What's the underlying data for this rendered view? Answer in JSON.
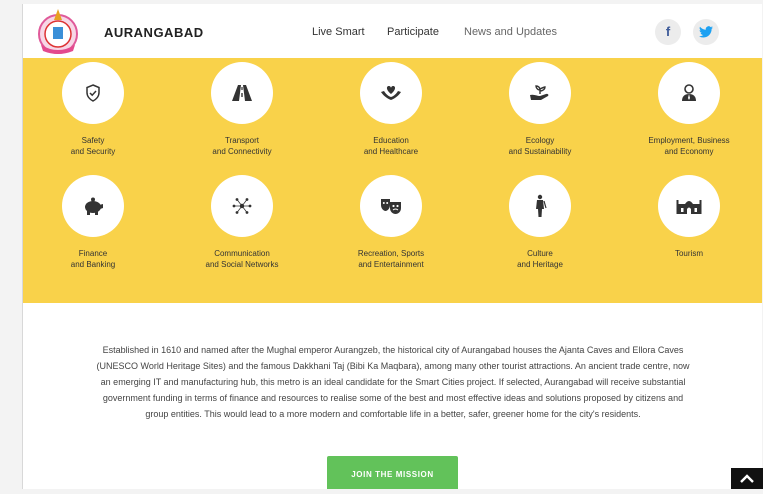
{
  "header": {
    "city_name": "AURANGABAD",
    "nav": [
      "Live Smart",
      "Participate",
      "News and Updates"
    ],
    "social": {
      "facebook": "f",
      "twitter": "t"
    }
  },
  "categories": [
    {
      "line1": "Safety",
      "line2": "and Security",
      "icon": "shield-check-icon"
    },
    {
      "line1": "Transport",
      "line2": "and Connectivity",
      "icon": "road-icon"
    },
    {
      "line1": "Education",
      "line2": "and Healthcare",
      "icon": "heart-hands-icon"
    },
    {
      "line1": "Ecology",
      "line2": "and Sustainability",
      "icon": "plant-hand-icon"
    },
    {
      "line1": "Employment, Business",
      "line2": "and Economy",
      "icon": "person-icon"
    },
    {
      "line1": "Finance",
      "line2": "and Banking",
      "icon": "piggy-bank-icon"
    },
    {
      "line1": "Communication",
      "line2": "and Social Networks",
      "icon": "network-icon"
    },
    {
      "line1": "Recreation, Sports",
      "line2": "and Entertainment",
      "icon": "theatre-masks-icon"
    },
    {
      "line1": "Culture",
      "line2": "and Heritage",
      "icon": "statue-icon"
    },
    {
      "line1": "Tourism",
      "line2": "",
      "icon": "monument-icon"
    }
  ],
  "about": {
    "text": "Established in 1610 and named after the Mughal emperor Aurangzeb, the historical city of Aurangabad houses the Ajanta Caves and Ellora Caves (UNESCO World Heritage Sites) and the famous Dakkhani Taj (Bibi Ka Maqbara), among many other tourist attractions. An ancient trade centre, now an emerging IT and manufacturing hub, this metro is an ideal candidate for the Smart Cities project. If selected, Aurangabad will receive substantial government funding in terms of finance and resources to realise some of the best and most effective ideas and solutions proposed by citizens and group entities. This would lead to a more modern and comfortable life in a better, safer, greener home for the city's residents."
  },
  "cta": {
    "label": "JOIN THE MISSION"
  },
  "colors": {
    "accent": "#f9d24a",
    "button": "#62c25a"
  }
}
